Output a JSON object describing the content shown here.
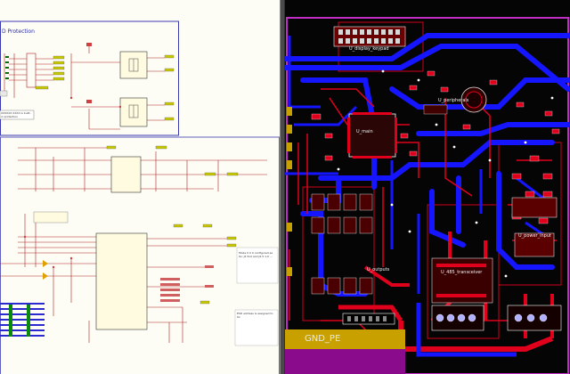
{
  "schematic": {
    "section_title": "D Protection",
    "notes": {
      "top_left": "XXXXXX XXXX is built-in protection",
      "bottom_right": "ESD address is assigned to 0x",
      "mid_right": "Mode 0 0 0 configured as 0x; J2 5x2 and J2.5 1.0 ..."
    }
  },
  "pcb": {
    "labels": {
      "display": "U_display_keypad",
      "peripherals": "U_peripherals",
      "main": "U_main",
      "outputs": "U_outputs",
      "transceiver": "U_485_transceiver",
      "power_input": "U_power_input",
      "gnd": "GND_PE"
    },
    "colors": {
      "board": "#050505",
      "top_copper": "#e0001c",
      "bottom_copper": "#1515ff",
      "keepout": "#c02ec4",
      "gnd_pad": "#c8a000"
    }
  }
}
